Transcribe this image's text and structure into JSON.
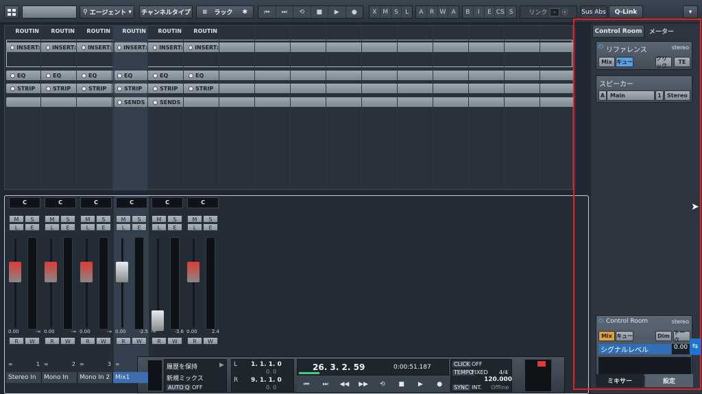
{
  "toolbar": {
    "agent_label": "エージェント",
    "channel_type_label": "チャンネルタイプ",
    "rack_label": "ラック",
    "view_buttons": [
      "X",
      "M",
      "S",
      "L"
    ],
    "auto_buttons": [
      "A",
      "R",
      "W",
      "A"
    ],
    "edit_buttons": [
      "B",
      "I",
      "E",
      "CS",
      "S"
    ],
    "link_label": "リンク",
    "sus_abs_label": "Sus Abs",
    "qlink_label": "Q-Link",
    "link_value": "-"
  },
  "routing": {
    "headers": [
      "ROUTIN",
      "ROUTIN",
      "ROUTIN",
      "ROUTIN",
      "ROUTIN",
      "ROUTIN"
    ],
    "insert_label": "INSERT:",
    "eq_label": "EQ",
    "strip_label": "STRIP",
    "sends_label": "SENDS"
  },
  "channels": [
    {
      "name": "Stereo In",
      "num": "1",
      "pan": "C",
      "vol": "0.00",
      "peak": "-∞",
      "fader": 0.62,
      "color": "#e03a35",
      "selected": false
    },
    {
      "name": "Mono In",
      "num": "2",
      "pan": "C",
      "vol": "0.00",
      "peak": "-∞",
      "fader": 0.62,
      "color": "#e03a35",
      "selected": false
    },
    {
      "name": "Mono In 2",
      "num": "3",
      "pan": "C",
      "vol": "0.00",
      "peak": "-∞",
      "fader": 0.62,
      "color": "#e03a35",
      "selected": false
    },
    {
      "name": "Mix1",
      "num": "",
      "pan": "C",
      "vol": "0.00",
      "peak": "-2.5",
      "fader": 0.62,
      "color": "#e8edf2",
      "selected": true
    },
    {
      "name": "",
      "num": "",
      "pan": "C",
      "vol": "-∞",
      "peak": "-3.6",
      "fader": 0.08,
      "color": "#e8edf2",
      "selected": false
    },
    {
      "name": "",
      "num": "",
      "pan": "C",
      "vol": "0.00",
      "peak": "2.4",
      "fader": 0.62,
      "color": "#e03a35",
      "selected": false
    }
  ],
  "ms_labels": {
    "m": "M",
    "s": "S",
    "l": "L",
    "e": "E",
    "r": "R",
    "w": "W"
  },
  "right_panel": {
    "tab_control_room": "Control Room",
    "tab_meter": "メーター",
    "reference_label": "リファレンス",
    "reference_format": "stereo",
    "mix_btn": "Mix",
    "cue_btn": "キュー",
    "click_btn": "クリック",
    "te_btn": "TE",
    "speaker_label": "スピーカー",
    "speaker_a": "A",
    "speaker_main": "Main",
    "speaker_num": "1",
    "speaker_fmt": "Stereo",
    "cr_label": "Control Room",
    "cr_format": "stereo",
    "cr_mix_btn": "Mix",
    "cr_cue_btn": "キュー",
    "dim_btn": "Dim",
    "talk_btn": "トーク",
    "signal_label": "シグナルレベル",
    "signal_value": "0.00",
    "bottom_tab_mixer": "ミキサー",
    "bottom_tab_settings": "設定"
  },
  "transport": {
    "history_label": "履歴を保持",
    "new_mix_label": "新規ミックス",
    "auto_q_label": "AUTO Q",
    "auto_q_value": "OFF",
    "left_locator": "1. 1. 1.   0",
    "left_sub": "0. 0",
    "right_locator": "9. 1. 1.   0",
    "right_sub": "0. 0",
    "position": "26. 3. 2. 59",
    "time": "0:00:51.187",
    "click_label": "CLICK",
    "click_value": "OFF",
    "tempo_label": "TEMPO",
    "tempo_mode": "FIXED",
    "signature": "4/4",
    "tempo_value": "120.000",
    "sync_label": "SYNC",
    "sync_mode": "INT.",
    "sync_status": "Offline"
  }
}
